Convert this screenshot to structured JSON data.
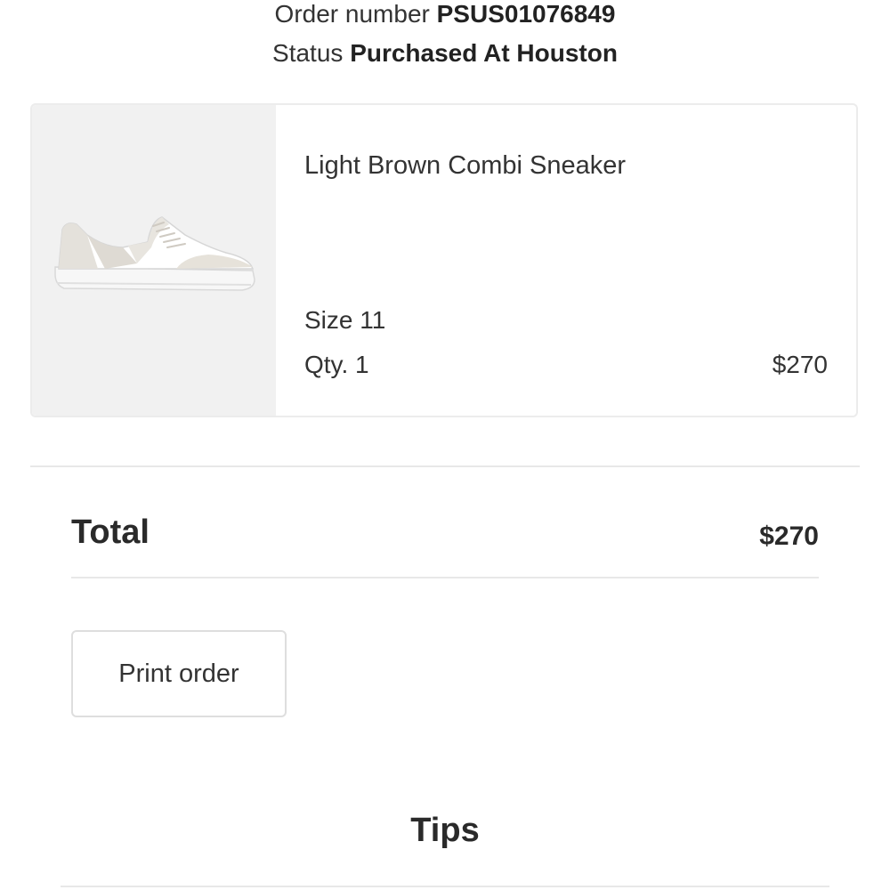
{
  "order": {
    "number_label": "Order number",
    "number_value": "PSUS01076849",
    "status_label": "Status",
    "status_value": "Purchased At Houston"
  },
  "product": {
    "image_icon": "sneaker-image",
    "name": "Light Brown Combi Sneaker",
    "size": "Size 11",
    "qty": "Qty. 1",
    "price": "$270"
  },
  "summary": {
    "total_label": "Total",
    "total_value": "$270"
  },
  "actions": {
    "print_label": "Print order"
  },
  "tips": {
    "heading": "Tips"
  },
  "colors": {
    "text": "#2b2b2b",
    "image_bg": "#f1f1f1",
    "border": "#e8e8e8"
  }
}
